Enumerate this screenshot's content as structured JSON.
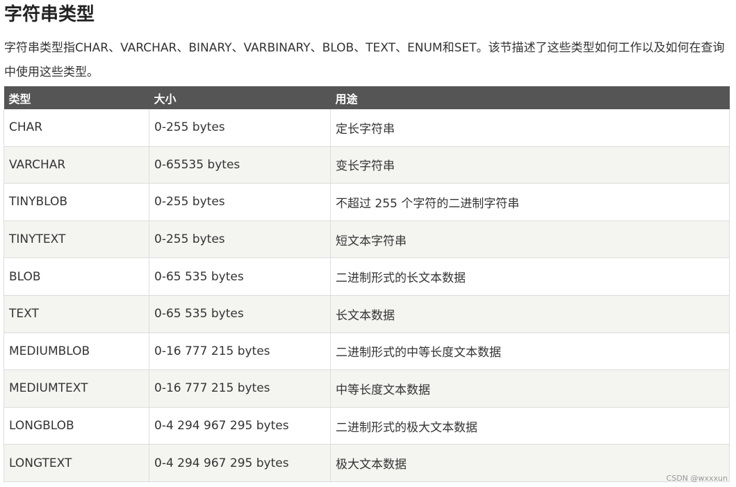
{
  "title": "字符串类型",
  "intro": "字符串类型指CHAR、VARCHAR、BINARY、VARBINARY、BLOB、TEXT、ENUM和SET。该节描述了这些类型如何工作以及如何在查询中使用这些类型。",
  "table": {
    "headers": [
      "类型",
      "大小",
      "用途"
    ],
    "rows": [
      {
        "type": "CHAR",
        "size": "0-255 bytes",
        "usage": "定长字符串"
      },
      {
        "type": "VARCHAR",
        "size": "0-65535 bytes",
        "usage": "变长字符串"
      },
      {
        "type": "TINYBLOB",
        "size": "0-255 bytes",
        "usage": "不超过 255 个字符的二进制字符串"
      },
      {
        "type": "TINYTEXT",
        "size": "0-255 bytes",
        "usage": "短文本字符串"
      },
      {
        "type": "BLOB",
        "size": "0-65 535 bytes",
        "usage": "二进制形式的长文本数据"
      },
      {
        "type": "TEXT",
        "size": "0-65 535 bytes",
        "usage": "长文本数据"
      },
      {
        "type": "MEDIUMBLOB",
        "size": "0-16 777 215 bytes",
        "usage": "二进制形式的中等长度文本数据"
      },
      {
        "type": "MEDIUMTEXT",
        "size": "0-16 777 215 bytes",
        "usage": "中等长度文本数据"
      },
      {
        "type": "LONGBLOB",
        "size": "0-4 294 967 295 bytes",
        "usage": "二进制形式的极大文本数据"
      },
      {
        "type": "LONGTEXT",
        "size": "0-4 294 967 295 bytes",
        "usage": "极大文本数据"
      }
    ]
  },
  "watermark": "CSDN @wxxxun",
  "colors": {
    "header_bg": "#555555",
    "header_text": "#ffffff",
    "stripe_bg": "#f4f4f1",
    "border": "#dddddd"
  }
}
